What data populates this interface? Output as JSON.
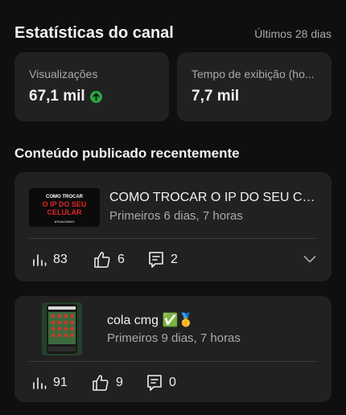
{
  "header": {
    "title": "Estatísticas do canal",
    "period": "Últimos 28 dias"
  },
  "stats": {
    "views": {
      "label": "Visualizações",
      "value": "67,1 mil",
      "trend": "up",
      "trend_color": "#2ba640"
    },
    "watch_time": {
      "label": "Tempo de exibição (ho...",
      "value": "7,7 mil"
    }
  },
  "recent": {
    "title": "Conteúdo publicado recentemente",
    "videos": [
      {
        "title": "COMO TROCAR O IP DO SEU CEL...",
        "subtitle": "Primeiros 6 dias, 7 horas",
        "thumb_text": {
          "line1": "COMO TROCAR",
          "line2": "O IP DO SEU",
          "line3": "CELULAR",
          "line4": "ATUALIZADO"
        },
        "views": "83",
        "likes": "6",
        "comments": "2"
      },
      {
        "title": "cola cmg ✅🥇",
        "subtitle": "Primeiros 9 dias, 7 horas",
        "views": "91",
        "likes": "9",
        "comments": "0"
      }
    ]
  },
  "colors": {
    "background": "#0f0f0f",
    "card": "#212121",
    "secondary_text": "#aaaaaa",
    "accent_green": "#2ba640",
    "thumb_red": "#e02424"
  },
  "icons": [
    "arrow-up-circle-icon",
    "bar-chart-icon",
    "thumbs-up-icon",
    "comment-icon",
    "chevron-down-icon"
  ]
}
